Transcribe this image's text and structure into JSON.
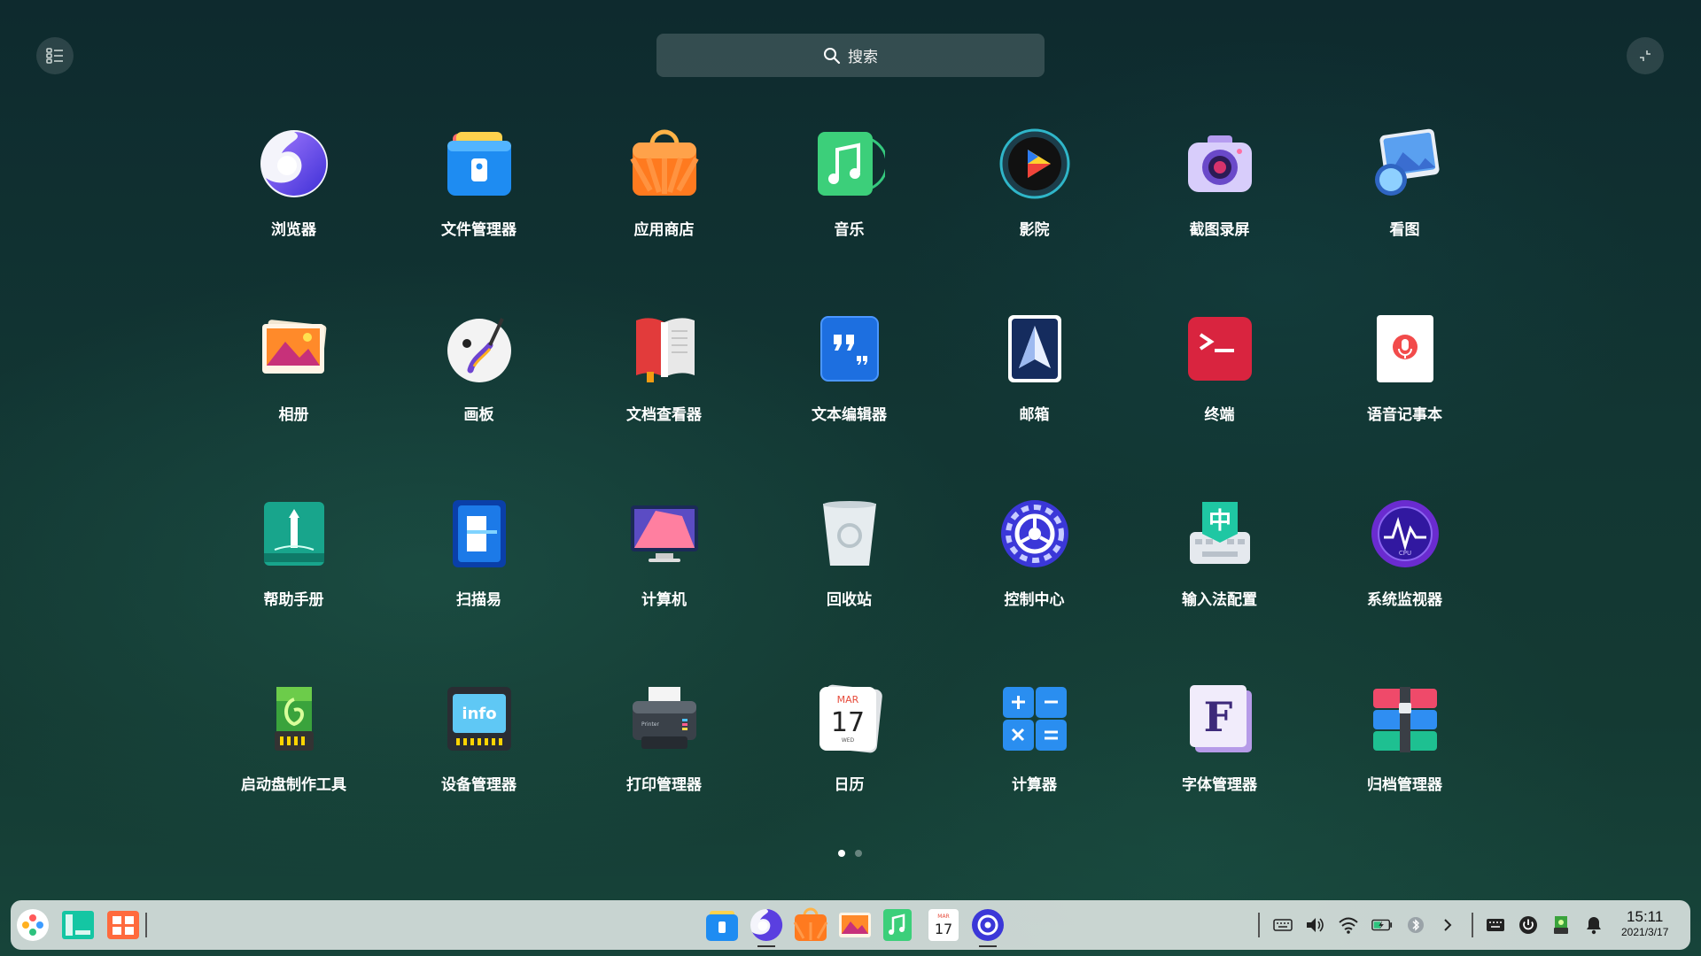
{
  "search": {
    "label": "搜索"
  },
  "apps": [
    {
      "label": "浏览器",
      "icon": "browser-icon"
    },
    {
      "label": "文件管理器",
      "icon": "file-manager-icon"
    },
    {
      "label": "应用商店",
      "icon": "app-store-icon"
    },
    {
      "label": "音乐",
      "icon": "music-icon"
    },
    {
      "label": "影院",
      "icon": "movie-icon"
    },
    {
      "label": "截图录屏",
      "icon": "screenshot-icon"
    },
    {
      "label": "看图",
      "icon": "image-viewer-icon"
    },
    {
      "label": "相册",
      "icon": "album-icon"
    },
    {
      "label": "画板",
      "icon": "draw-icon"
    },
    {
      "label": "文档查看器",
      "icon": "document-viewer-icon"
    },
    {
      "label": "文本编辑器",
      "icon": "text-editor-icon"
    },
    {
      "label": "邮箱",
      "icon": "mail-icon"
    },
    {
      "label": "终端",
      "icon": "terminal-icon"
    },
    {
      "label": "语音记事本",
      "icon": "voice-note-icon"
    },
    {
      "label": "帮助手册",
      "icon": "manual-icon"
    },
    {
      "label": "扫描易",
      "icon": "scanner-icon"
    },
    {
      "label": "计算机",
      "icon": "computer-icon"
    },
    {
      "label": "回收站",
      "icon": "trash-icon"
    },
    {
      "label": "控制中心",
      "icon": "control-center-icon"
    },
    {
      "label": "输入法配置",
      "icon": "input-method-icon"
    },
    {
      "label": "系统监视器",
      "icon": "system-monitor-icon"
    },
    {
      "label": "启动盘制作工具",
      "icon": "boot-maker-icon"
    },
    {
      "label": "设备管理器",
      "icon": "device-manager-icon"
    },
    {
      "label": "打印管理器",
      "icon": "print-manager-icon"
    },
    {
      "label": "日历",
      "icon": "calendar-icon"
    },
    {
      "label": "计算器",
      "icon": "calculator-icon"
    },
    {
      "label": "字体管理器",
      "icon": "font-manager-icon"
    },
    {
      "label": "归档管理器",
      "icon": "archive-manager-icon"
    }
  ],
  "calendar": {
    "month": "MAR",
    "day": "17",
    "weekday": "WED"
  },
  "text_icons": {
    "info": "info",
    "font": "F",
    "ime": "中",
    "cpu": "CPU",
    "printer": "Printer"
  },
  "pager": {
    "pages": 2,
    "current": 1
  },
  "dock": {
    "left": [
      "launcher-icon",
      "multitask-view-icon",
      "show-desktop-icon"
    ],
    "apps": [
      "file-manager-icon",
      "browser-icon",
      "app-store-icon",
      "album-icon",
      "music-icon",
      "calendar-icon",
      "control-center-icon"
    ]
  },
  "clock": {
    "time": "15:11",
    "date": "2021/3/17"
  }
}
